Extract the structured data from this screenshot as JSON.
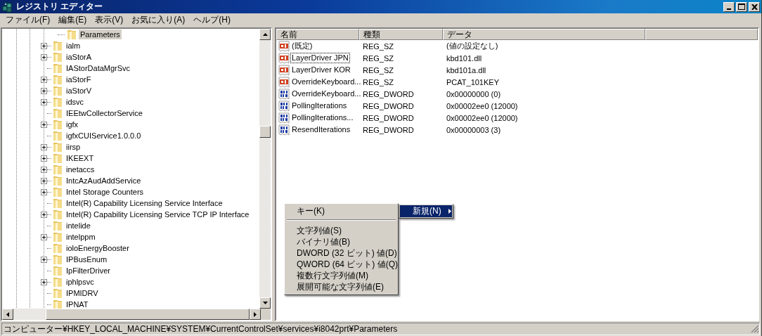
{
  "window": {
    "title": "レジストリ エディター"
  },
  "menu": [
    "ファイル(F)",
    "編集(E)",
    "表示(V)",
    "お気に入り(A)",
    "ヘルプ(H)"
  ],
  "tree": {
    "items": [
      {
        "children": [
          {
            "label": "Parameters",
            "selected": true
          }
        ]
      },
      {
        "label": "ialm",
        "expandable": true,
        "selected": false
      },
      {
        "label": "iaStorA",
        "expandable": true,
        "selected": false
      },
      {
        "label": "IAStorDataMgrSvc",
        "expandable": false,
        "selected": false
      },
      {
        "label": "iaStorF",
        "expandable": true,
        "selected": false
      },
      {
        "label": "iaStorV",
        "expandable": true,
        "selected": false
      },
      {
        "label": "idsvc",
        "expandable": true,
        "selected": false
      },
      {
        "label": "IEEtwCollectorService",
        "expandable": false,
        "selected": false
      },
      {
        "label": "igfx",
        "expandable": true,
        "selected": false
      },
      {
        "label": "igfxCUIService1.0.0.0",
        "expandable": false,
        "selected": false
      },
      {
        "label": "iirsp",
        "expandable": true,
        "selected": false
      },
      {
        "label": "IKEEXT",
        "expandable": true,
        "selected": false
      },
      {
        "label": "inetaccs",
        "expandable": true,
        "selected": false
      },
      {
        "label": "IntcAzAudAddService",
        "expandable": true,
        "selected": false
      },
      {
        "label": "Intel Storage Counters",
        "expandable": true,
        "selected": false
      },
      {
        "label": "Intel(R) Capability Licensing Service Interface",
        "expandable": false,
        "selected": false
      },
      {
        "label": "Intel(R) Capability Licensing Service TCP IP Interface",
        "expandable": true,
        "selected": false
      },
      {
        "label": "intelide",
        "expandable": false,
        "selected": false
      },
      {
        "label": "intelppm",
        "expandable": true,
        "selected": false
      },
      {
        "label": "ioloEnergyBooster",
        "expandable": false,
        "selected": false
      },
      {
        "label": "IPBusEnum",
        "expandable": true,
        "selected": false
      },
      {
        "label": "IpFilterDriver",
        "expandable": false,
        "selected": false
      },
      {
        "label": "iphlpsvc",
        "expandable": true,
        "selected": false
      },
      {
        "label": "IPMIDRV",
        "expandable": false,
        "selected": false
      },
      {
        "label": "IPNAT",
        "expandable": false,
        "selected": false
      }
    ]
  },
  "values": {
    "columns": [
      "名前",
      "種類",
      "データ"
    ],
    "rows": [
      {
        "kind": "string",
        "name": "(既定)",
        "type": "REG_SZ",
        "data": "(値の設定なし)",
        "focused": false
      },
      {
        "kind": "string",
        "name": "LayerDriver JPN",
        "type": "REG_SZ",
        "data": "kbd101.dll",
        "focused": true
      },
      {
        "kind": "string",
        "name": "LayerDriver KOR",
        "type": "REG_SZ",
        "data": "kbd101a.dll",
        "focused": false
      },
      {
        "kind": "string",
        "name": "OverrideKeyboard...",
        "type": "REG_SZ",
        "data": "PCAT_101KEY",
        "focused": false
      },
      {
        "kind": "binary",
        "name": "OverrideKeyboard...",
        "type": "REG_DWORD",
        "data": "0x00000000 (0)",
        "focused": false
      },
      {
        "kind": "binary",
        "name": "PollingIterations",
        "type": "REG_DWORD",
        "data": "0x00002ee0 (12000)",
        "focused": false
      },
      {
        "kind": "binary",
        "name": "PollingIterations...",
        "type": "REG_DWORD",
        "data": "0x00002ee0 (12000)",
        "focused": false
      },
      {
        "kind": "binary",
        "name": "ResendIterations",
        "type": "REG_DWORD",
        "data": "0x00000003 (3)",
        "focused": false
      }
    ]
  },
  "context_menu": {
    "items": [
      {
        "label": "新規(N)",
        "selected": true
      }
    ]
  },
  "submenu": {
    "items": [
      {
        "kind": "item",
        "label": "キー(K)"
      },
      {
        "kind": "separator"
      },
      {
        "kind": "item",
        "label": "文字列値(S)"
      },
      {
        "kind": "item",
        "label": "バイナリ値(B)"
      },
      {
        "kind": "item",
        "label": "DWORD (32 ビット) 値(D)"
      },
      {
        "kind": "item",
        "label": "QWORD (64 ビット) 値(Q)"
      },
      {
        "kind": "item",
        "label": "複数行文字列値(M)"
      },
      {
        "kind": "item",
        "label": "展開可能な文字列値(E)"
      }
    ]
  },
  "status_bar": "コンピューター¥HKEY_LOCAL_MACHINE¥SYSTEM¥CurrentControlSet¥services¥i8042prt¥Parameters"
}
